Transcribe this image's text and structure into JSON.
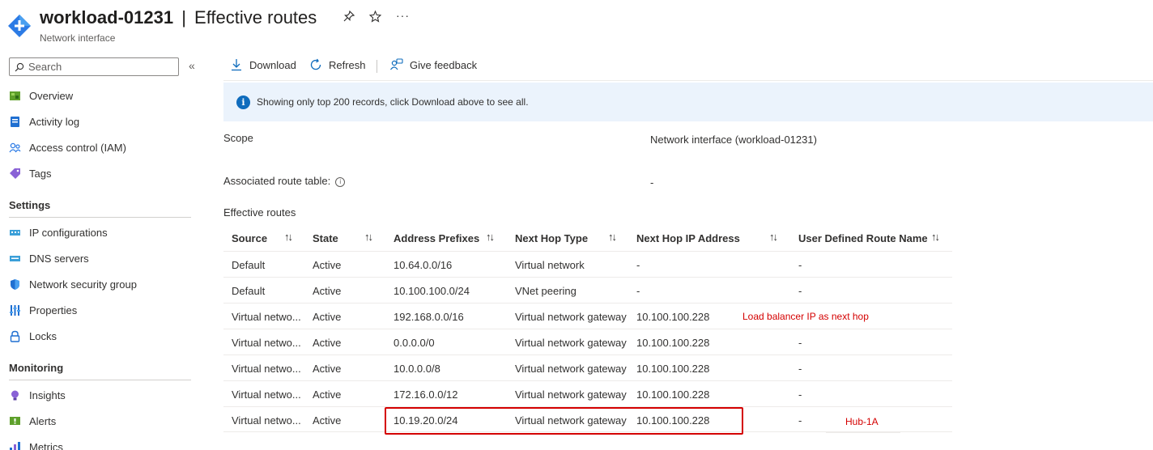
{
  "header": {
    "resource_name": "workload-01231",
    "separator": "|",
    "page_title": "Effective routes",
    "subtitle": "Network interface",
    "pin_icon": "pin-icon",
    "star_icon": "star-icon",
    "more_icon": "ellipsis-icon"
  },
  "sidebar": {
    "search_placeholder": "Search",
    "collapse_glyph": "«",
    "top_items": [
      {
        "label": "Overview",
        "icon": "overview-icon"
      },
      {
        "label": "Activity log",
        "icon": "activity-log-icon"
      },
      {
        "label": "Access control (IAM)",
        "icon": "iam-icon"
      },
      {
        "label": "Tags",
        "icon": "tag-icon"
      }
    ],
    "settings_heading": "Settings",
    "settings_items": [
      {
        "label": "IP configurations",
        "icon": "ip-config-icon"
      },
      {
        "label": "DNS servers",
        "icon": "dns-icon"
      },
      {
        "label": "Network security group",
        "icon": "shield-icon"
      },
      {
        "label": "Properties",
        "icon": "properties-icon"
      },
      {
        "label": "Locks",
        "icon": "lock-icon"
      }
    ],
    "monitoring_heading": "Monitoring",
    "monitoring_items": [
      {
        "label": "Insights",
        "icon": "insights-icon"
      },
      {
        "label": "Alerts",
        "icon": "alert-icon"
      },
      {
        "label": "Metrics",
        "icon": "metrics-icon"
      }
    ]
  },
  "toolbar": {
    "download_label": "Download",
    "refresh_label": "Refresh",
    "feedback_label": "Give feedback"
  },
  "banner": {
    "text": "Showing only top 200 records, click Download above to see all."
  },
  "essentials": {
    "scope_label": "Scope",
    "scope_value": "Network interface (workload-01231)",
    "route_table_label": "Associated route table:",
    "route_table_value": "-",
    "section_title": "Effective routes"
  },
  "table": {
    "columns": [
      "Source",
      "State",
      "Address Prefixes",
      "Next Hop Type",
      "Next Hop IP Address",
      "User Defined Route Name"
    ],
    "sort_glyph": "↑↓",
    "rows": [
      {
        "source": "Default",
        "state": "Active",
        "prefix": "10.64.0.0/16",
        "hop_type": "Virtual network",
        "hop_ip": "-",
        "udr": "-"
      },
      {
        "source": "Default",
        "state": "Active",
        "prefix": "10.100.100.0/24",
        "hop_type": "VNet peering",
        "hop_ip": "-",
        "udr": "-"
      },
      {
        "source": "Virtual netwo...",
        "state": "Active",
        "prefix": "192.168.0.0/16",
        "hop_type": "Virtual network gateway",
        "hop_ip": "10.100.100.228",
        "udr": ""
      },
      {
        "source": "Virtual netwo...",
        "state": "Active",
        "prefix": "0.0.0.0/0",
        "hop_type": "Virtual network gateway",
        "hop_ip": "10.100.100.228",
        "udr": "-"
      },
      {
        "source": "Virtual netwo...",
        "state": "Active",
        "prefix": "10.0.0.0/8",
        "hop_type": "Virtual network gateway",
        "hop_ip": "10.100.100.228",
        "udr": "-"
      },
      {
        "source": "Virtual netwo...",
        "state": "Active",
        "prefix": "172.16.0.0/12",
        "hop_type": "Virtual network gateway",
        "hop_ip": "10.100.100.228",
        "udr": "-"
      },
      {
        "source": "Virtual netwo...",
        "state": "Active",
        "prefix": "10.19.20.0/24",
        "hop_type": "Virtual network gateway",
        "hop_ip": "10.100.100.228",
        "udr": "-"
      }
    ]
  },
  "annotations": {
    "lb_note": "Load balancer IP as next hop",
    "hub_note": "Hub-1A",
    "color": "#d40000"
  },
  "colors": {
    "accent": "#0f6cbd",
    "banner_bg": "#ebf3fc",
    "annotation_red": "#d40000"
  }
}
